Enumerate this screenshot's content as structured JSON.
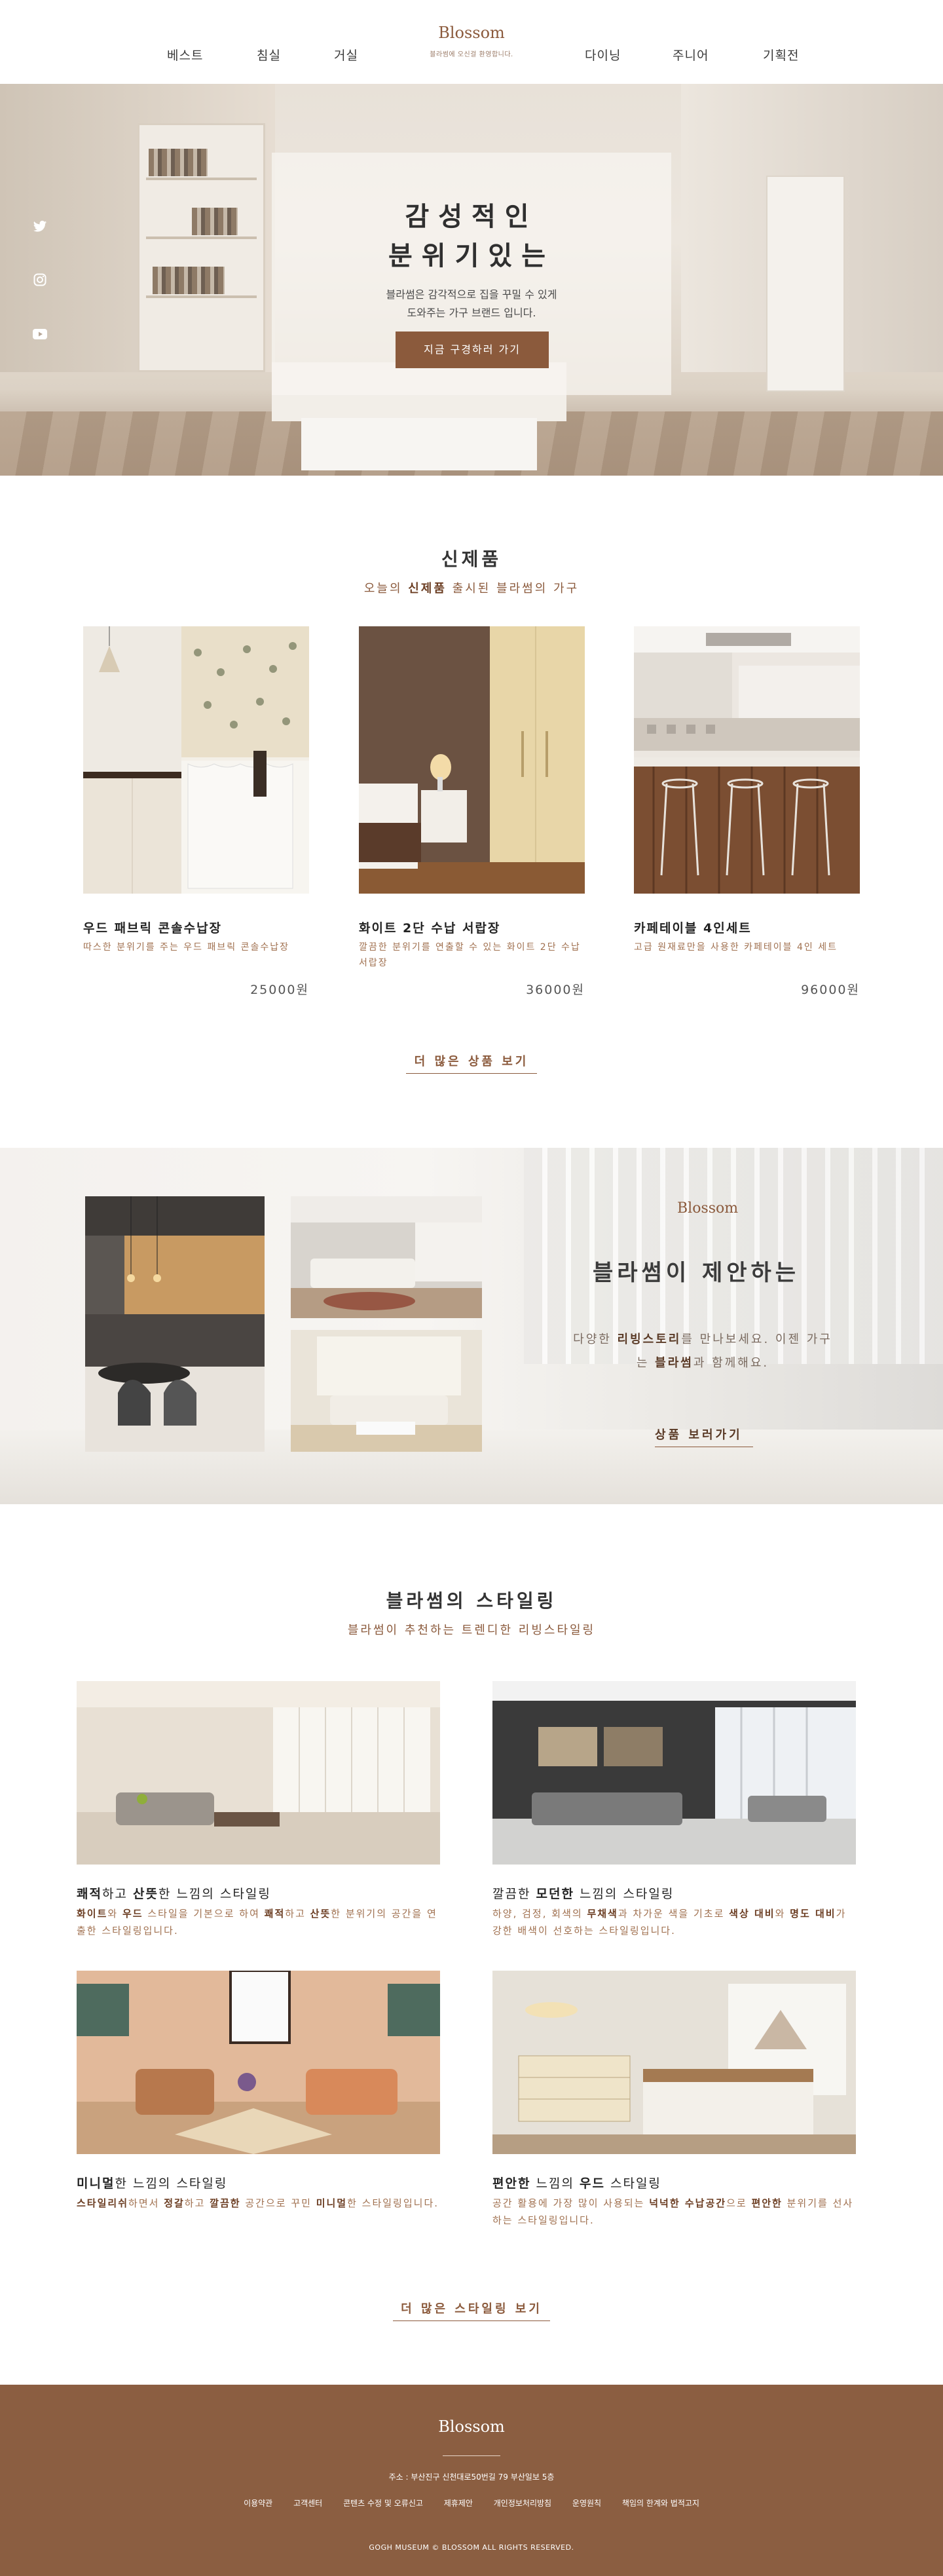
{
  "header": {
    "nav_left": [
      "베스트",
      "침실",
      "거실"
    ],
    "nav_right": [
      "다이닝",
      "주니어",
      "기획전"
    ],
    "logo": "Blossom",
    "logo_sub": "블라썸에 오신걸 환영합니다."
  },
  "hero": {
    "title_line1": "감성적인",
    "title_line2": "분위기있는",
    "desc_line1": "블라썸은 감각적으로 집을 꾸밀 수 있게",
    "desc_line2": "도와주는 가구 브랜드 입니다.",
    "button": "지금 구경하러 가기",
    "social_icons": [
      "twitter-icon",
      "instagram-icon",
      "youtube-icon"
    ]
  },
  "new_products": {
    "title": "신제품",
    "subtitle_pre": "오늘의 ",
    "subtitle_bold": "신제품",
    "subtitle_post": " 출시된 블라썸의 가구",
    "items": [
      {
        "name": "우드 패브릭 콘솔수납장",
        "desc": "따스한 분위기를 주는 우드 패브릭 콘솔수납장",
        "price": "25000원"
      },
      {
        "name": "화이트 2단 수납 서랍장",
        "desc": "깔끔한 분위기를 연출할 수 있는 화이트 2단 수납 서랍장",
        "price": "36000원"
      },
      {
        "name": "카페테이블 4인세트",
        "desc": "고급 원재료만을 사용한 카페테이블 4인 세트",
        "price": "96000원"
      }
    ],
    "more": "더 많은 상품 보기"
  },
  "banner": {
    "logo": "Blossom",
    "title": "블라썸이 제안하는",
    "desc1_pre": "다양한 ",
    "desc1_bold": "리빙스토리",
    "desc1_post": "를 만나보세요. 이젠 가구",
    "desc2_pre": "는 ",
    "desc2_bold": "블라썸",
    "desc2_post": "과 함께해요.",
    "link": "상품 보러가기"
  },
  "styling": {
    "title": "블라썸의 스타일링",
    "subtitle": "블라썸이 추천하는 트렌디한 리빙스타일링",
    "items": [
      {
        "name_parts": [
          [
            "쾌적",
            1
          ],
          [
            "하고 ",
            0
          ],
          [
            "산뜻",
            1
          ],
          [
            "한 느낌의 스타일링",
            0
          ]
        ],
        "desc_parts": [
          [
            "화이트",
            1
          ],
          [
            "와 ",
            0
          ],
          [
            "우드",
            1
          ],
          [
            " 스타일을 기본으로 하여 ",
            0
          ],
          [
            "쾌적",
            1
          ],
          [
            "하고 ",
            0
          ],
          [
            "산뜻",
            1
          ],
          [
            "한 분위기의 공간을 연출한 스타일링입니다.",
            0
          ]
        ]
      },
      {
        "name_parts": [
          [
            "깔끔한 ",
            0
          ],
          [
            "모던한",
            1
          ],
          [
            " 느낌의 스타일링",
            0
          ]
        ],
        "desc_parts": [
          [
            "하양, 검정, 회색의 ",
            0
          ],
          [
            "무채색",
            1
          ],
          [
            "과 차가운 색을 기초로 ",
            0
          ],
          [
            "색상 대비",
            1
          ],
          [
            "와 ",
            0
          ],
          [
            "명도 대비",
            1
          ],
          [
            "가 강한 배색이 선호하는 스타일링입니다.",
            0
          ]
        ]
      },
      {
        "name_parts": [
          [
            "미니멀",
            1
          ],
          [
            "한 느낌의 스타일링",
            0
          ]
        ],
        "desc_parts": [
          [
            "스타일리쉬",
            1
          ],
          [
            "하면서 ",
            0
          ],
          [
            "정갈",
            1
          ],
          [
            "하고 ",
            0
          ],
          [
            "깔끔한",
            1
          ],
          [
            " 공간으로 꾸민 ",
            0
          ],
          [
            "미니멀",
            1
          ],
          [
            "한 스타일링입니다.",
            0
          ]
        ]
      },
      {
        "name_parts": [
          [
            "편안한",
            1
          ],
          [
            " 느낌의 ",
            0
          ],
          [
            "우드",
            1
          ],
          [
            " 스타일링",
            0
          ]
        ],
        "desc_parts": [
          [
            "공간 활용에 가장 많이 사용되는 ",
            0
          ],
          [
            "넉넉한 수납공간",
            1
          ],
          [
            "으로 ",
            0
          ],
          [
            "편안한",
            1
          ],
          [
            " 분위기를 선사하는 스타일링입니다.",
            0
          ]
        ]
      }
    ],
    "more": "더 많은 스타일링 보기"
  },
  "footer": {
    "logo": "Blossom",
    "address": "주소 : 부산진구 신천대로50번길 79 부산일보 5층",
    "links": [
      "이용약관",
      "고객센터",
      "콘텐츠 수정 및 오류신고",
      "제휴제안",
      "개인정보처리방침",
      "운영원칙",
      "책임의 한계와 법적고지"
    ],
    "copyright": "GOGH MUSEUM © BLOSSOM ALL RIGHTS RESERVED."
  },
  "colors": {
    "brand": "#8b5a3c",
    "footer_bg": "#8b5e41",
    "accent_text": "#a0704f"
  }
}
